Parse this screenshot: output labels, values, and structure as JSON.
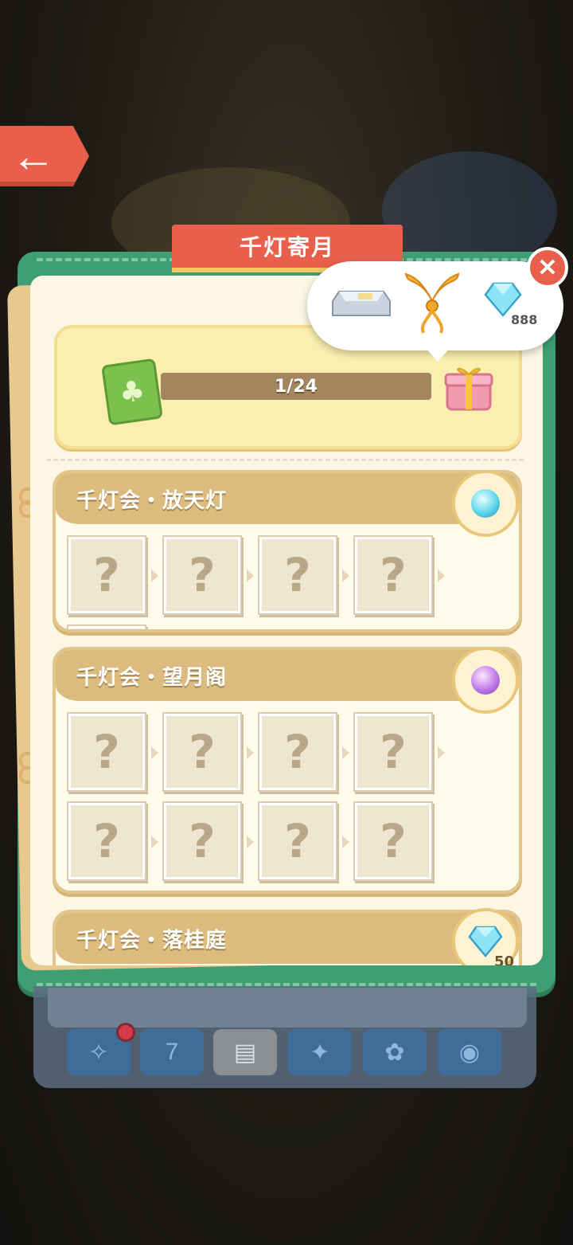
{
  "window": {
    "title": "千灯寄月"
  },
  "progress": {
    "value_text": "1/24",
    "current": 1,
    "total": 24
  },
  "reward_popup": {
    "items": [
      {
        "icon": "floor-tile-icon"
      },
      {
        "icon": "golden-wings-icon"
      },
      {
        "icon": "diamond-icon",
        "count": "888"
      }
    ]
  },
  "sections": [
    {
      "title": "千灯会・放天灯",
      "badge_icon": "blue-orb-icon",
      "slots": [
        "?",
        "?",
        "?",
        "?",
        "?"
      ]
    },
    {
      "title": "千灯会・望月阁",
      "badge_icon": "purple-orb-icon",
      "slots": [
        "?",
        "?",
        "?",
        "?",
        "?",
        "?",
        "?",
        "?"
      ]
    },
    {
      "title": "千灯会・落桂庭",
      "badge_icon": "diamond-icon",
      "badge_count": "50"
    }
  ],
  "tabs": [
    {
      "icon": "party-popper-icon",
      "has_notification": true
    },
    {
      "icon": "calendar-icon",
      "label": "7"
    },
    {
      "icon": "ticket-album-icon",
      "active": true
    },
    {
      "icon": "gift-icon"
    },
    {
      "icon": "leaf-icon"
    },
    {
      "icon": "potion-icon"
    }
  ],
  "colors": {
    "accent_red": "#e8604c",
    "book_green": "#3f9f73",
    "section_tan": "#dcbb7e"
  }
}
